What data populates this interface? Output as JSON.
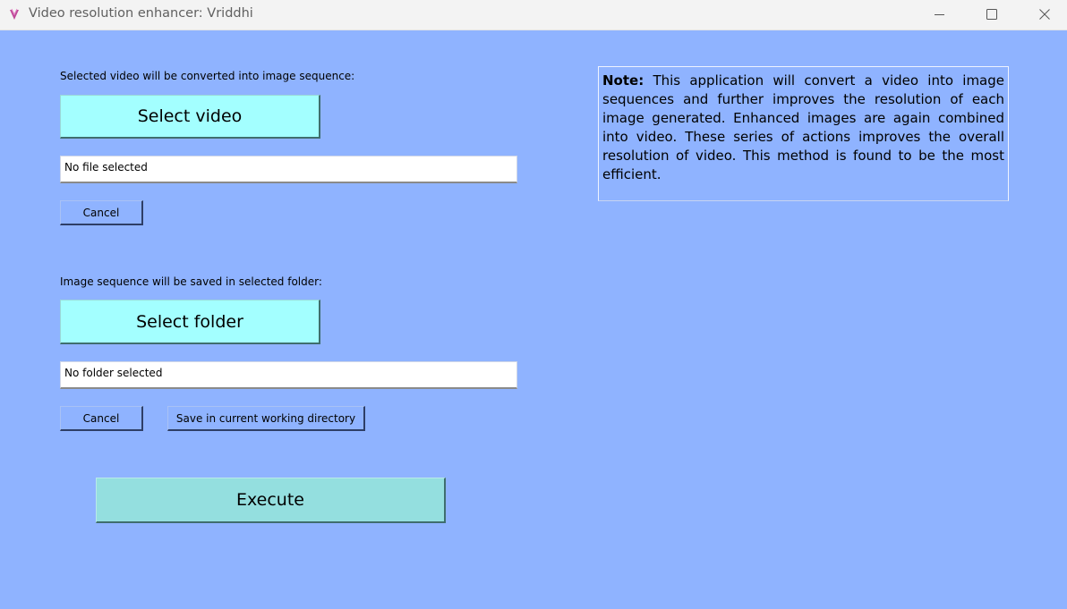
{
  "window": {
    "title": "Video resolution enhancer: Vriddhi",
    "icon": "app-logo-icon",
    "controls": {
      "minimize": "minimize-icon",
      "maximize": "maximize-icon",
      "close": "close-icon"
    }
  },
  "video_section": {
    "label": "Selected video will be converted into image sequence:",
    "select_button": "Select video",
    "status": "No file selected",
    "cancel_button": "Cancel"
  },
  "folder_section": {
    "label": "Image sequence will be saved in selected folder:",
    "select_button": "Select folder",
    "status": "No folder selected",
    "cancel_button": "Cancel",
    "cwd_button": "Save in current working directory"
  },
  "execute_button": "Execute",
  "note": {
    "heading": "Note:",
    "text": " This application will convert a video into image sequences and further improves the resolution of each image generated. Enhanced images are again combined into video. These series of actions improves the overall resolution of video. This method is found to be the most efficient."
  },
  "colors": {
    "background": "#8fb3ff",
    "select_button": "#a3ffff",
    "execute_button": "#94dfdf",
    "titlebar": "#f3f3f3"
  }
}
